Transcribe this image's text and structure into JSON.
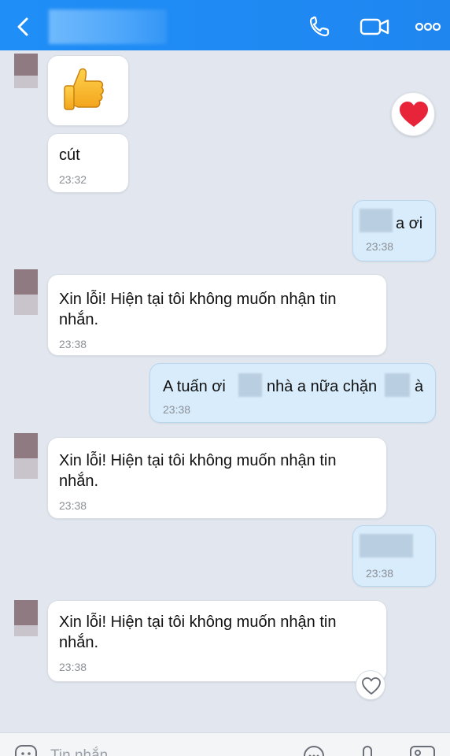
{
  "header": {
    "contact_name": "",
    "icons": [
      "back-icon",
      "phone-icon",
      "video-call-icon",
      "more-icon"
    ]
  },
  "messages": [
    {
      "side": "left",
      "type": "sticker",
      "content": "thumbs-up-icon",
      "reaction": "heart"
    },
    {
      "side": "left",
      "text": "cút",
      "time": "23:32"
    },
    {
      "side": "right",
      "text": "a ơi",
      "time": "23:38"
    },
    {
      "side": "left",
      "text_line1": "Xin lỗi! Hiện tại tôi không muốn nhận tin",
      "text_line2": "nhắn.",
      "time": "23:38"
    },
    {
      "side": "right",
      "text_part1": "A tuấn ơi",
      "text_part2": "nhà a nữa chặn",
      "text_part3": "à",
      "time": "23:38"
    },
    {
      "side": "left",
      "text_line1": "Xin lỗi! Hiện tại tôi không muốn nhận tin",
      "text_line2": "nhắn.",
      "time": "23:38"
    },
    {
      "side": "right",
      "text": "",
      "time": "23:38"
    },
    {
      "side": "left",
      "text_line1": "Xin lỗi! Hiện tại tôi không muốn nhận tin",
      "text_line2": "nhắn.",
      "time": "23:38",
      "reaction": "empty-heart"
    }
  ],
  "input": {
    "placeholder": "Tin nhắn"
  },
  "colors": {
    "header": "#1f8ef6",
    "background": "#e2e7ef",
    "my_bubble": "#d8ecfb",
    "their_bubble": "#ffffff",
    "heart": "#e8243a"
  }
}
